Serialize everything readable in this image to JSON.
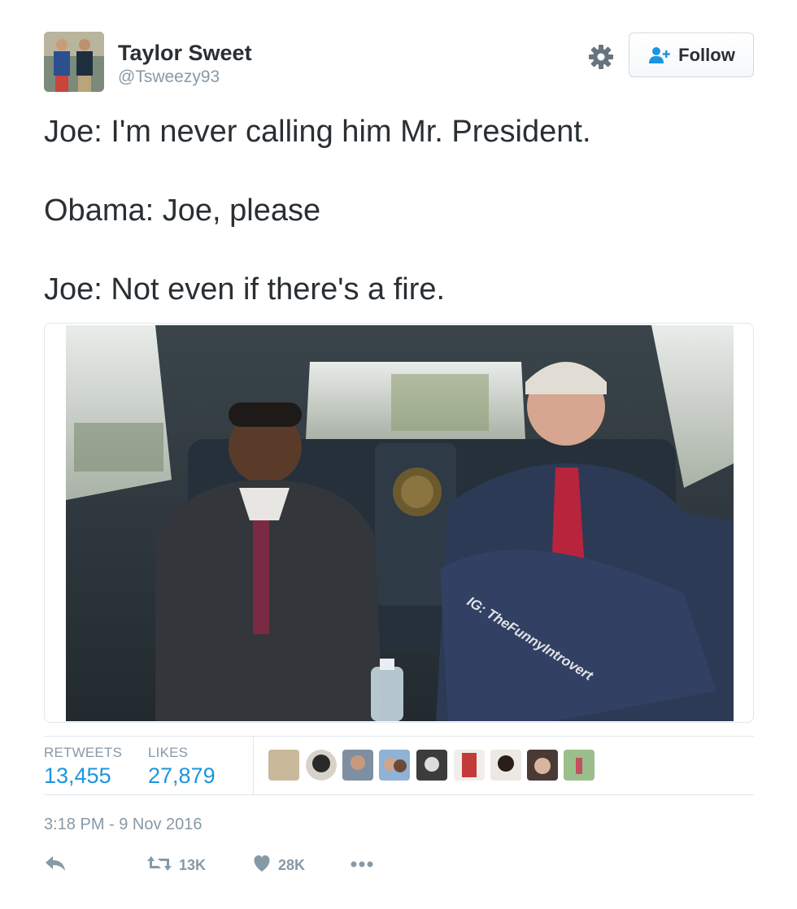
{
  "user": {
    "name": "Taylor Sweet",
    "handle": "@Tsweezy93"
  },
  "header": {
    "follow_label": "Follow",
    "gear_icon": "gear-icon",
    "follow_icon": "add-user-icon"
  },
  "tweet": {
    "lines": [
      "Joe: I'm never calling him Mr. President.",
      "Obama: Joe, please",
      "Joe: Not even if there's a fire."
    ],
    "media": {
      "watermark": "IG: TheFunnyIntrovert"
    }
  },
  "stats": {
    "retweets_label": "RETWEETS",
    "retweets_value": "13,455",
    "likes_label": "LIKES",
    "likes_value": "27,879"
  },
  "timestamp": "3:18 PM - 9 Nov 2016",
  "actions": {
    "reply_icon": "reply-icon",
    "retweet_icon": "retweet-icon",
    "retweet_count": "13K",
    "like_icon": "heart-icon",
    "like_count": "28K",
    "more_icon": "more-dots-icon"
  },
  "colors": {
    "link_blue": "#1b95e0",
    "muted_gray": "#8899a6",
    "text": "#292f33",
    "border": "#e1e8ed"
  }
}
